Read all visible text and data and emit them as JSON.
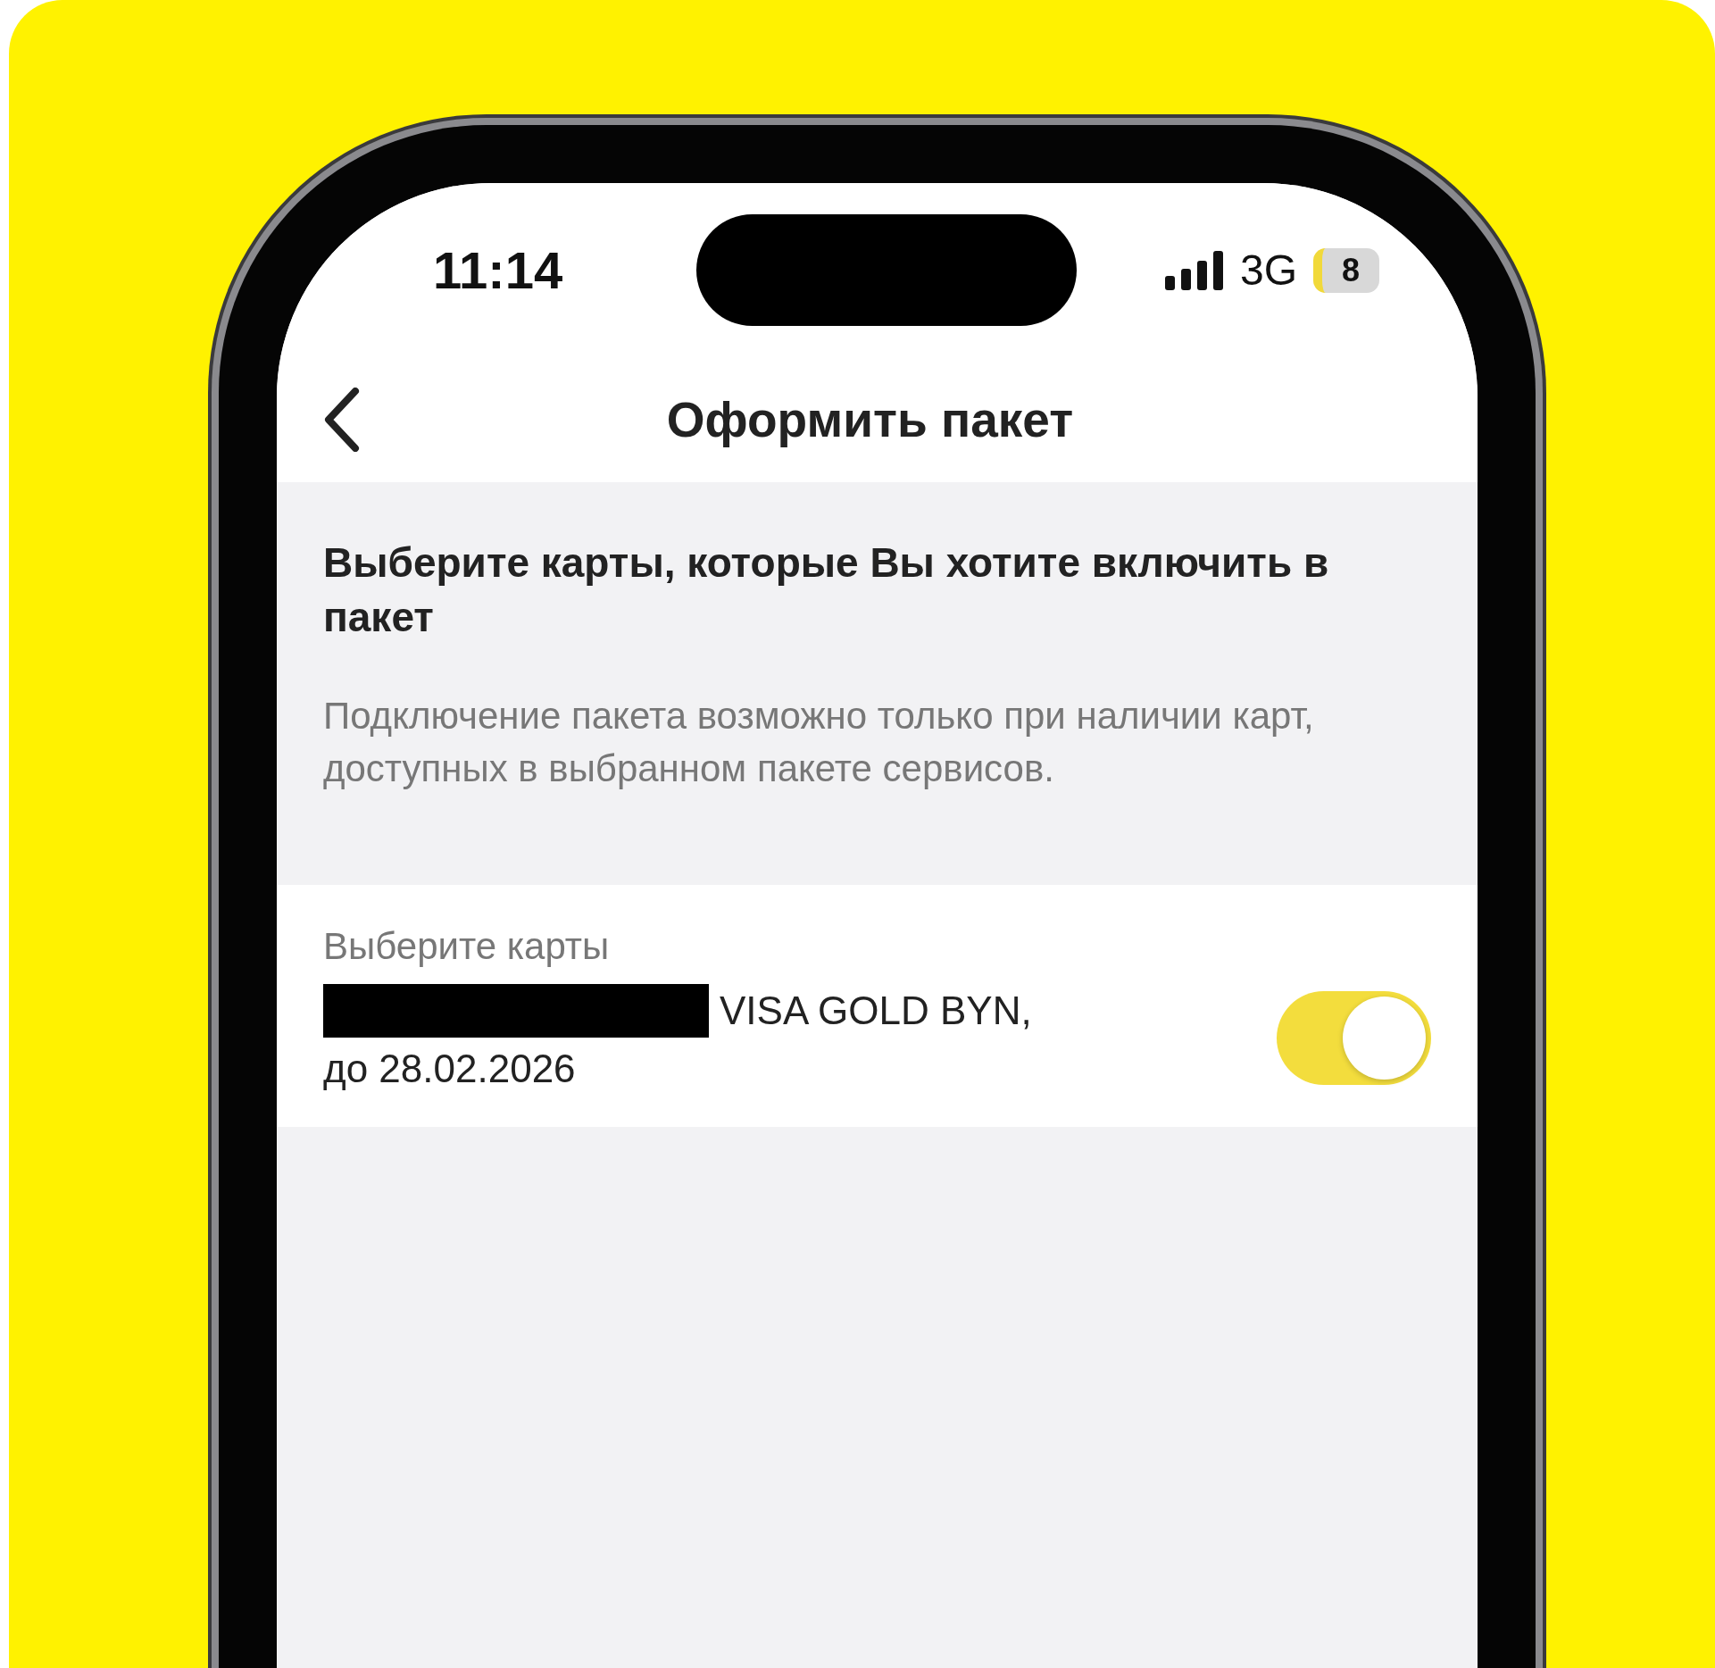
{
  "status_bar": {
    "time": "11:14",
    "network": "3G",
    "battery": "8"
  },
  "header": {
    "title": "Оформить пакет"
  },
  "intro": {
    "heading": "Выберите карты, которые Вы хотите включить в пакет",
    "note": "Подключение пакета возможно только при наличии карт, доступных в выбранном пакете сервисов."
  },
  "cards_section": {
    "label": "Выберите карты",
    "cards": [
      {
        "name": "VISA GOLD BYN,",
        "expiry": "до 28.02.2026",
        "on": true
      }
    ]
  }
}
